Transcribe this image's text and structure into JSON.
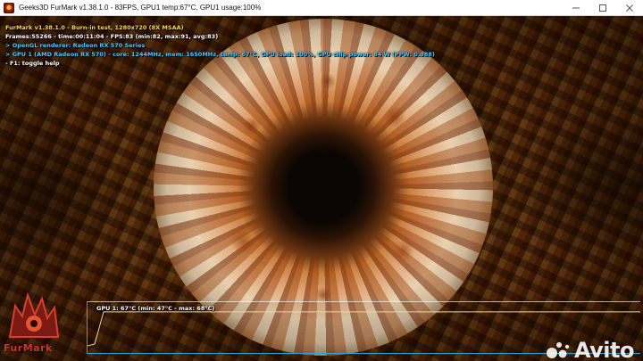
{
  "window": {
    "title": "Geeks3D FurMark v1.38.1.0 - 83FPS, GPU1 temp:67°C, GPU1 usage:100%",
    "icon": "furmark-app-icon",
    "controls": [
      "minimize-icon",
      "maximize-icon",
      "close-icon"
    ]
  },
  "osd": {
    "lines": [
      "FurMark v1.38.1.0 - Burn-in test, 1280x720 (8X MSAA)",
      "Frames:55266 - time:00:11:04 - FPS:83 (min:82, max:91, avg:83)",
      "> OpenGL renderer: Radeon RX 570 Series",
      "> GPU 1 (AMD Radeon RX 570) - core: 1244MHz, mem: 1650MHz, temp: 67°C, GPU load: 100%, GPU chip power: 84 W (PPW: 0.988)",
      "- F1: toggle help"
    ],
    "colors": {
      "title": "#ffd84a",
      "stats": "#ffffff",
      "info": "#4ec9ff"
    }
  },
  "temp_graph": {
    "label": "GPU 1: 67°C (min: 47°C - max: 68°C)",
    "line_color": "#f0d2a0",
    "frame_color": "#2fa3d6",
    "current_level": 0.88
  },
  "logo": {
    "text": "FurMark",
    "color": "#c8372a"
  },
  "watermark": {
    "text": "Avito"
  }
}
